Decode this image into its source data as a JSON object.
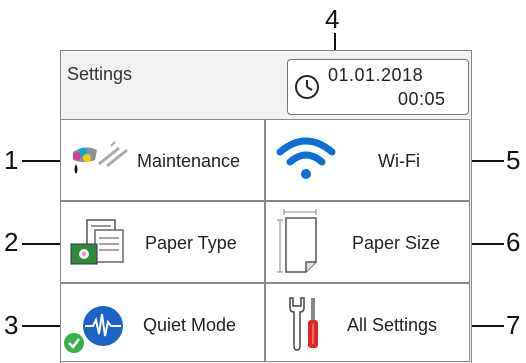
{
  "header": {
    "title": "Settings"
  },
  "datetime": {
    "date": "01.01.2018",
    "time": "00:05",
    "icon": "clock-icon"
  },
  "tiles": [
    {
      "label": "Maintenance",
      "icon": "ink-cartridges-icon",
      "callout": "1"
    },
    {
      "label": "Wi-Fi",
      "icon": "wifi-icon",
      "callout": "5"
    },
    {
      "label": "Paper Type",
      "icon": "paper-type-icon",
      "callout": "2"
    },
    {
      "label": "Paper Size",
      "icon": "paper-size-icon",
      "callout": "6"
    },
    {
      "label": "Quiet Mode",
      "icon": "quiet-mode-icon",
      "callout": "3"
    },
    {
      "label": "All Settings",
      "icon": "tools-icon",
      "callout": "7"
    }
  ],
  "datetime_callout": "4",
  "colors": {
    "wifi_blue": "#0b6fd6",
    "quiet_blue": "#1b63c6",
    "check_green": "#38b14a",
    "tool_red": "#d8282a"
  }
}
